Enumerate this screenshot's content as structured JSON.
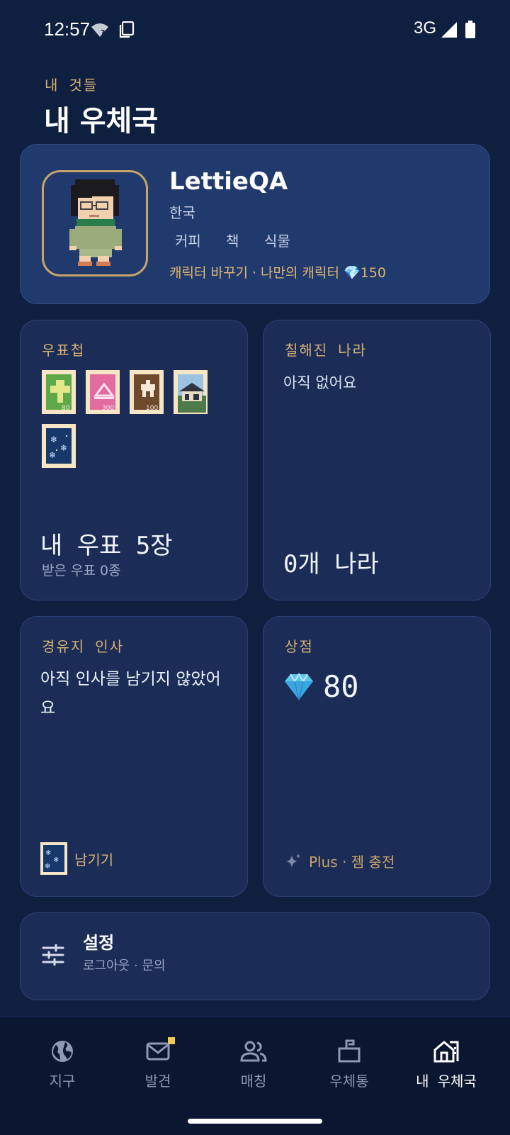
{
  "status_bar": {
    "time": "12:57",
    "network": "3G"
  },
  "header": {
    "eyebrow": "내 것들",
    "title": "내 우체국"
  },
  "profile": {
    "name": "LettieQA",
    "country": "한국",
    "interests": [
      "커피",
      "책",
      "식물"
    ],
    "action_text": "캐릭터 바꾸기 · 나만의 캐릭터 💎150"
  },
  "stamps_card": {
    "label": "우표첩",
    "stamp_values": [
      "80",
      "300",
      "100"
    ],
    "count_text": "내 우표 5장",
    "received_text": "받은 우표 0종"
  },
  "visited_card": {
    "label": "칠해진 나라",
    "empty_text": "아직 없어요",
    "count_text": "0개 나라"
  },
  "greeting_card": {
    "label": "경유지 인사",
    "empty_text": "아직 인사를 남기지 않았어요",
    "action_label": "남기기"
  },
  "shop_card": {
    "label": "상점",
    "gem_icon": "💎",
    "gems": "80",
    "plus_text": "Plus · 젬 충전"
  },
  "settings": {
    "title": "설정",
    "subtitle": "로그아웃 · 문의"
  },
  "nav": [
    {
      "label": "지구",
      "icon": "globe-icon",
      "active": false
    },
    {
      "label": "발견",
      "icon": "mail-icon",
      "active": false,
      "badge": true
    },
    {
      "label": "매칭",
      "icon": "people-icon",
      "active": false
    },
    {
      "label": "우체통",
      "icon": "mailbox-icon",
      "active": false
    },
    {
      "label": "내 우체국",
      "icon": "post-office-icon",
      "active": true
    }
  ],
  "colors": {
    "background": "#0f1f40",
    "card": "#1b2d57",
    "accent": "#d9b173",
    "badge": "#f2c94c"
  }
}
